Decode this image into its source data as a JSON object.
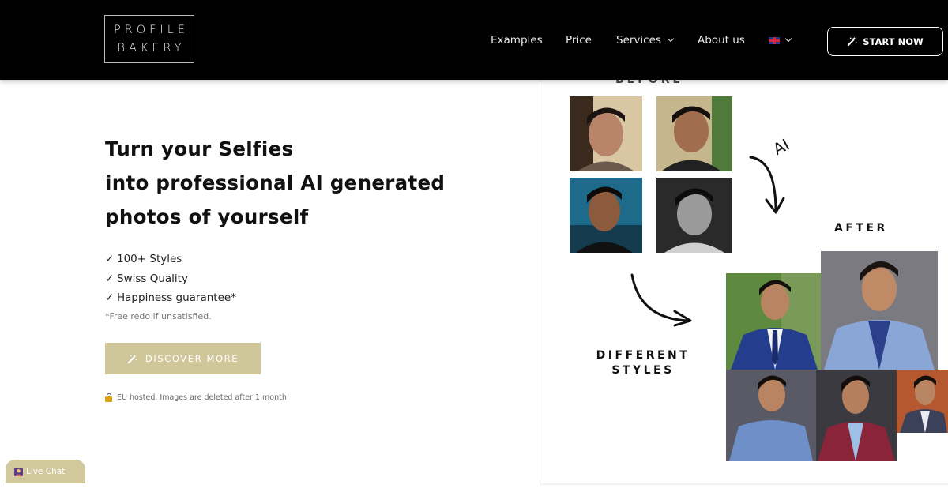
{
  "header": {
    "logo": {
      "line1": "PROFILE",
      "line2": "BAKERY"
    },
    "nav": [
      {
        "label": "Examples"
      },
      {
        "label": "Price"
      },
      {
        "label": "Services"
      },
      {
        "label": "About us"
      }
    ],
    "cta_label": "START NOW"
  },
  "hero": {
    "title_lines": [
      "Turn your Selfies",
      "into professional AI generated",
      "photos of yourself"
    ],
    "features": [
      "100+ Styles",
      "Swiss Quality",
      "Happiness guarantee*"
    ],
    "check_glyph": "✓",
    "footnote": "*Free redo if unsatisfied.",
    "discover_label": "DISCOVER MORE",
    "eu_note": "EU hosted, Images are deleted after 1 month"
  },
  "panel": {
    "top_label": "BEFORE",
    "ai_label": "AI",
    "after_label": "AFTER",
    "styles_label": [
      "DIFFERENT",
      "STYLES"
    ]
  },
  "livechat": {
    "label": "Live Chat"
  },
  "colors": {
    "header_bg": "#000000",
    "accent": "#cfc699",
    "text": "#111111"
  },
  "icons": [
    "magic-wand-icon",
    "chevron-down-icon",
    "uk-flag-icon",
    "lock-icon",
    "chat-avatar-icon",
    "arrow-icon"
  ]
}
